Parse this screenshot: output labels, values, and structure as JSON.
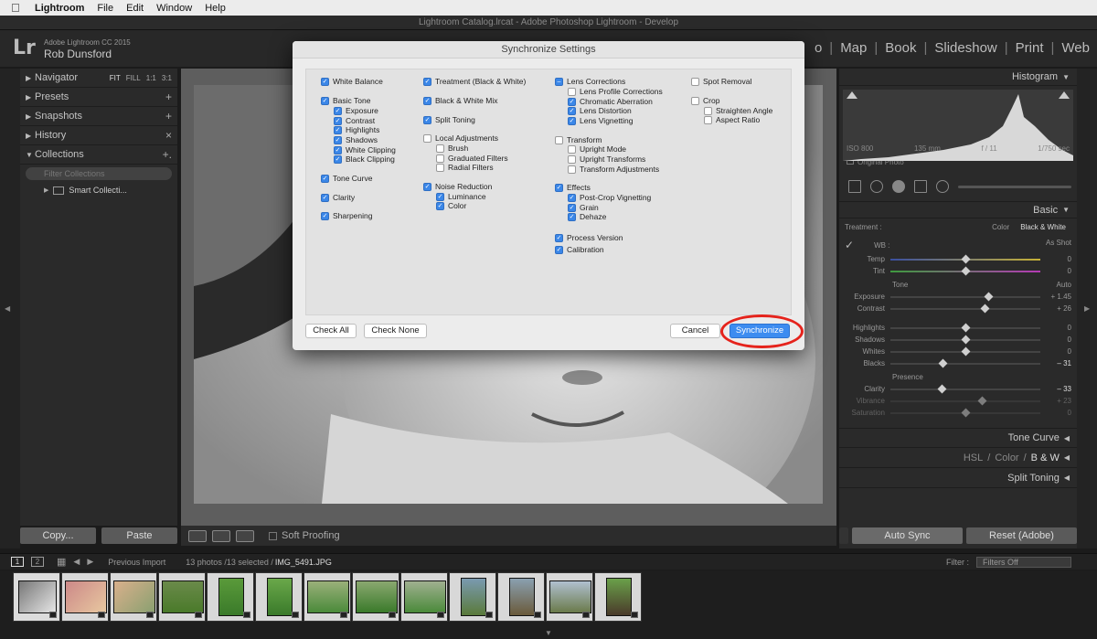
{
  "menubar": {
    "apple": "",
    "app": "Lightroom",
    "items": [
      "File",
      "Edit",
      "Window",
      "Help"
    ]
  },
  "window_title": "Lightroom Catalog.lrcat - Adobe Photoshop Lightroom - Develop",
  "identity": {
    "logo": "Lr",
    "product": "Adobe Lightroom CC 2015",
    "user": "Rob Dunsford"
  },
  "modules": [
    "o",
    "Map",
    "Book",
    "Slideshow",
    "Print",
    "Web"
  ],
  "left_panel": {
    "navigator": {
      "label": "Navigator",
      "zoom": [
        "FIT",
        "FILL",
        "1:1",
        "3:1"
      ]
    },
    "presets": {
      "label": "Presets",
      "ctrl": "+"
    },
    "snapshots": {
      "label": "Snapshots",
      "ctrl": "+"
    },
    "history": {
      "label": "History",
      "ctrl": "×"
    },
    "collections": {
      "label": "Collections",
      "ctrl": "+.",
      "filter_placeholder": "Filter Collections",
      "item": "Smart Collecti..."
    }
  },
  "left_buttons": {
    "copy": "Copy...",
    "paste": "Paste"
  },
  "toolbar": {
    "soft_proofing": "Soft Proofing"
  },
  "right_panel": {
    "histogram": {
      "label": "Histogram",
      "iso": "ISO 800",
      "focal": "135 mm",
      "aperture": "f / 11",
      "shutter": "1/750 sec",
      "original": "Original Photo"
    },
    "basic": {
      "label": "Basic",
      "treatment_label": "Treatment :",
      "treatment_options": [
        "Color",
        "Black & White"
      ],
      "wb_label": "WB :",
      "wb_value": "As Shot",
      "temp": {
        "label": "Temp",
        "value": "0",
        "pos": 0.5
      },
      "tint": {
        "label": "Tint",
        "value": "0",
        "pos": 0.5
      },
      "tone_label": "Tone",
      "auto": "Auto",
      "exposure": {
        "label": "Exposure",
        "value": "+ 1.45",
        "pos": 0.65
      },
      "contrast": {
        "label": "Contrast",
        "value": "+ 26",
        "pos": 0.63
      },
      "highlights": {
        "label": "Highlights",
        "value": "0",
        "pos": 0.5
      },
      "shadows": {
        "label": "Shadows",
        "value": "0",
        "pos": 0.5
      },
      "whites": {
        "label": "Whites",
        "value": "0",
        "pos": 0.5
      },
      "blacks": {
        "label": "Blacks",
        "value": "– 31",
        "pos": 0.35
      },
      "presence_label": "Presence",
      "clarity": {
        "label": "Clarity",
        "value": "– 33",
        "pos": 0.34
      },
      "vibrance": {
        "label": "Vibrance",
        "value": "+ 23",
        "pos": 0.61
      },
      "saturation": {
        "label": "Saturation",
        "value": "0",
        "pos": 0.5
      }
    },
    "tone_curve": "Tone Curve",
    "hsl": [
      "HSL",
      "Color",
      "B & W"
    ],
    "split_toning": "Split Toning"
  },
  "right_buttons": {
    "auto_sync": "Auto Sync",
    "reset": "Reset (Adobe)"
  },
  "filmstrip_bar": {
    "pages": [
      "1",
      "2"
    ],
    "source": "Previous Import",
    "count": "13 photos /13 selected /",
    "file": "IMG_5491.JPG",
    "filter_label": "Filter :",
    "filter_value": "Filters Off"
  },
  "modal": {
    "title": "Synchronize Settings",
    "col1": [
      {
        "label": "White Balance",
        "state": "on"
      },
      {
        "label": "Basic Tone",
        "state": "on"
      },
      {
        "label": "Exposure",
        "state": "on",
        "indent": true
      },
      {
        "label": "Contrast",
        "state": "on",
        "indent": true
      },
      {
        "label": "Highlights",
        "state": "on",
        "indent": true
      },
      {
        "label": "Shadows",
        "state": "on",
        "indent": true
      },
      {
        "label": "White Clipping",
        "state": "on",
        "indent": true
      },
      {
        "label": "Black Clipping",
        "state": "on",
        "indent": true
      },
      {
        "label": "Tone Curve",
        "state": "on"
      },
      {
        "label": "Clarity",
        "state": "on"
      },
      {
        "label": "Sharpening",
        "state": "on"
      }
    ],
    "col2": [
      {
        "label": "Treatment (Black & White)",
        "state": "on"
      },
      {
        "label": "Black & White Mix",
        "state": "on"
      },
      {
        "label": "Split Toning",
        "state": "on"
      },
      {
        "label": "Local Adjustments",
        "state": "off"
      },
      {
        "label": "Brush",
        "state": "off",
        "indent": true
      },
      {
        "label": "Graduated Filters",
        "state": "off",
        "indent": true
      },
      {
        "label": "Radial Filters",
        "state": "off",
        "indent": true
      },
      {
        "label": "Noise Reduction",
        "state": "on"
      },
      {
        "label": "Luminance",
        "state": "on",
        "indent": true
      },
      {
        "label": "Color",
        "state": "on",
        "indent": true
      }
    ],
    "col3": [
      {
        "label": "Lens Corrections",
        "state": "mix"
      },
      {
        "label": "Lens Profile Corrections",
        "state": "off",
        "indent": true
      },
      {
        "label": "Chromatic Aberration",
        "state": "on",
        "indent": true
      },
      {
        "label": "Lens Distortion",
        "state": "on",
        "indent": true
      },
      {
        "label": "Lens Vignetting",
        "state": "on",
        "indent": true
      },
      {
        "label": "Transform",
        "state": "off"
      },
      {
        "label": "Upright Mode",
        "state": "off",
        "indent": true
      },
      {
        "label": "Upright Transforms",
        "state": "off",
        "indent": true
      },
      {
        "label": "Transform Adjustments",
        "state": "off",
        "indent": true
      },
      {
        "label": "Effects",
        "state": "on"
      },
      {
        "label": "Post-Crop Vignetting",
        "state": "on",
        "indent": true
      },
      {
        "label": "Grain",
        "state": "on",
        "indent": true
      },
      {
        "label": "Dehaze",
        "state": "on",
        "indent": true
      },
      {
        "label": "Process Version",
        "state": "on"
      },
      {
        "label": "Calibration",
        "state": "on"
      }
    ],
    "col4": [
      {
        "label": "Spot Removal",
        "state": "off"
      },
      {
        "label": "Crop",
        "state": "off"
      },
      {
        "label": "Straighten Angle",
        "state": "off",
        "indent": true
      },
      {
        "label": "Aspect Ratio",
        "state": "off",
        "indent": true
      }
    ],
    "buttons": {
      "check_all": "Check All",
      "check_none": "Check None",
      "cancel": "Cancel",
      "synchronize": "Synchronize"
    }
  },
  "colors": {
    "accent": "#3d8cf0",
    "highlight_ring": "#e5231c"
  }
}
